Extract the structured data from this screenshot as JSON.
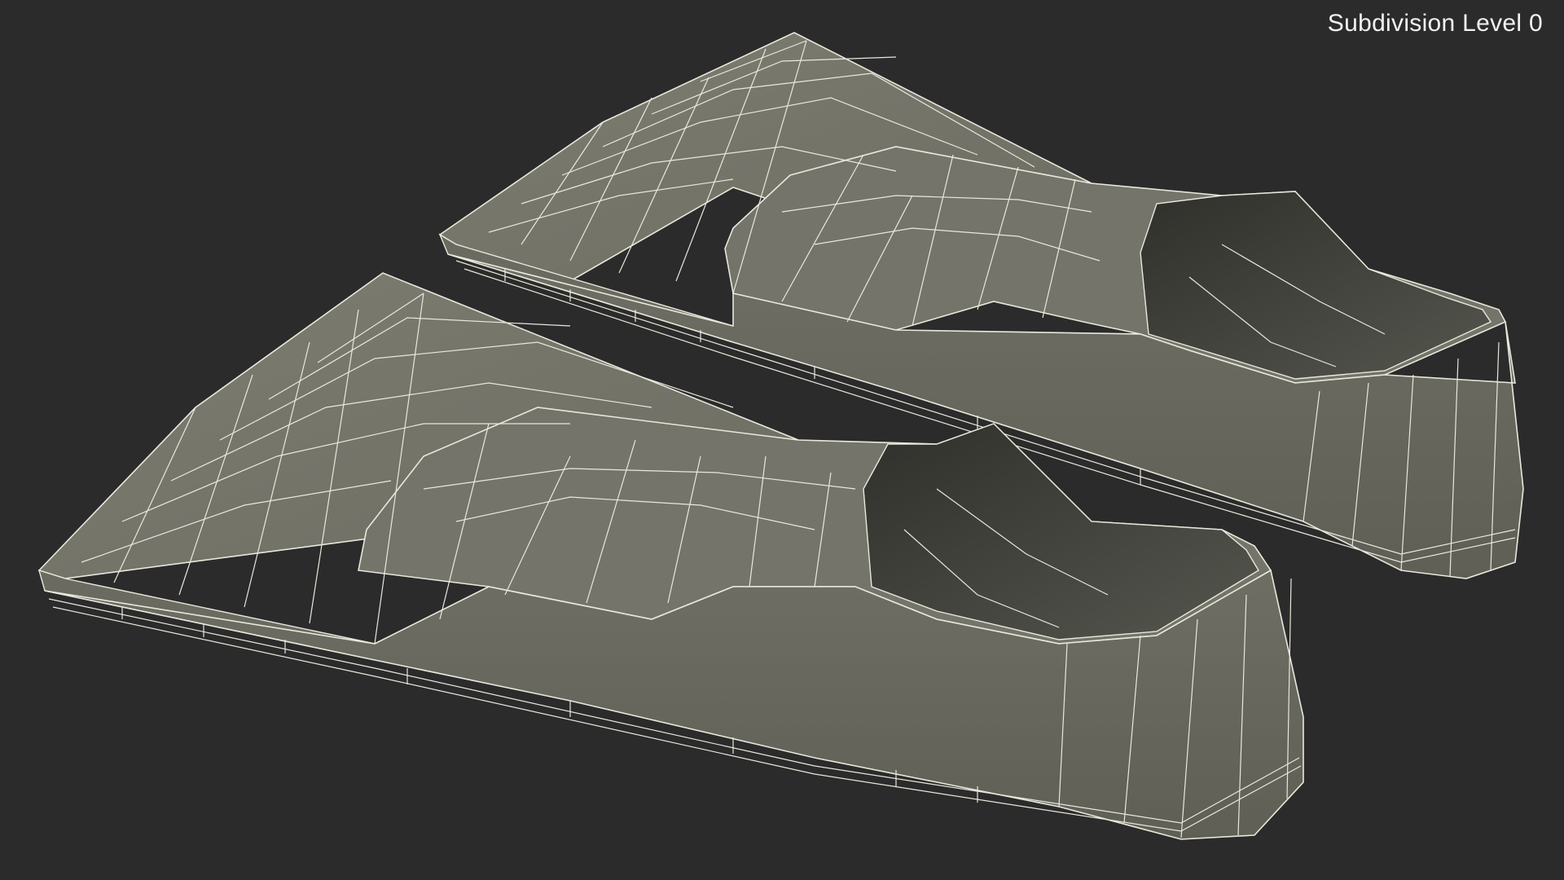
{
  "viewport": {
    "subdivision_label": "Subdivision Level 0"
  },
  "colors": {
    "background": "#2b2b2b",
    "mesh_surface": "#77776b",
    "mesh_shadow": "#5d5d53",
    "mesh_dark_inner": "#3a3b35",
    "wire": "#e8e8dc",
    "label_text": "#f2f2f2"
  },
  "scene": {
    "objects": [
      {
        "name": "swim-fin-back"
      },
      {
        "name": "swim-fin-front"
      }
    ]
  }
}
